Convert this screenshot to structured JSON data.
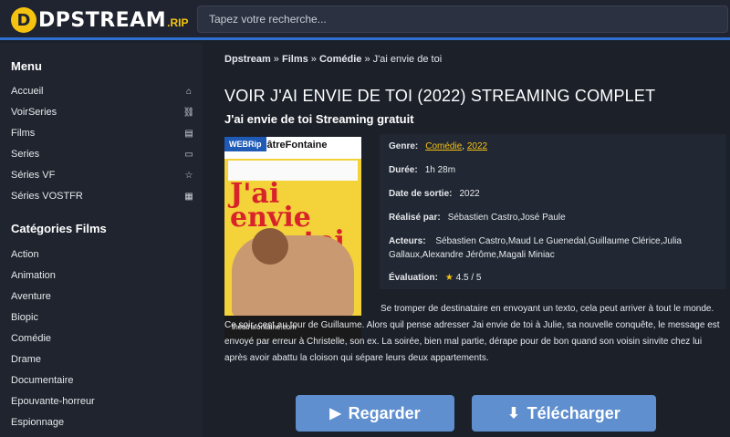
{
  "header": {
    "logo_initial": "D",
    "logo_text": "DPSTREAM",
    "logo_suffix": ".RIP",
    "search_placeholder": "Tapez votre recherche..."
  },
  "sidebar": {
    "menu_title": "Menu",
    "menu_items": [
      {
        "label": "Accueil",
        "icon": "home-icon",
        "glyph": "⌂"
      },
      {
        "label": "VoirSeries",
        "icon": "link-icon",
        "glyph": "⛓"
      },
      {
        "label": "Films",
        "icon": "film-icon",
        "glyph": "▤"
      },
      {
        "label": "Series",
        "icon": "tv-icon",
        "glyph": "▭"
      },
      {
        "label": "Séries VF",
        "icon": "star-icon",
        "glyph": "☆"
      },
      {
        "label": "Séries VOSTFR",
        "icon": "calendar-icon",
        "glyph": "▦"
      }
    ],
    "categories_title": "Catégories Films",
    "categories": [
      "Action",
      "Animation",
      "Aventure",
      "Biopic",
      "Comédie",
      "Drame",
      "Documentaire",
      "Epouvante-horreur",
      "Espionnage"
    ]
  },
  "breadcrumb": {
    "home": "Dpstream",
    "sep": " » ",
    "films": "Films",
    "genre": "Comédie",
    "current": "J'ai envie de toi"
  },
  "page": {
    "title": "VOIR J'AI ENVIE DE TOI (2022) STREAMING COMPLET",
    "subtitle": "J'ai envie de toi Streaming gratuit"
  },
  "poster": {
    "badge": "WEBRip",
    "brand": "théâtreFontaine",
    "big_text_1": "J'ai envie",
    "big_text_2": "de toi",
    "footer": "theatrefontaine.com"
  },
  "info": {
    "genre_label": "Genre:",
    "genre_1": "Comédie",
    "genre_sep": ", ",
    "genre_2": "2022",
    "duree_label": "Durée:",
    "duree": "1h 28m",
    "sortie_label": "Date de sortie:",
    "sortie": "2022",
    "realise_label": "Réalisé par:",
    "realise": "Sébastien Castro,José Paule",
    "acteurs_label": "Acteurs:",
    "acteurs": "Sébastien Castro,Maud Le Guenedal,Guillaume Clérice,Julia Gallaux,Alexandre Jérôme,Magali Miniac",
    "evaluation_label": "Évaluation:",
    "evaluation_star": "★",
    "evaluation": "4.5 / 5"
  },
  "description": {
    "line1": "Se tromper de destinataire en envoyant un texto, cela peut arriver à tout le monde. Ce soir, cest au tour de Guillaume. Alors quil pense adresser Jai envie de toi à Julie, sa nouvelle conquête, le message est envoyé par erreur à Christelle, son ex. La soirée, bien mal partie, dérape pour de bon quand son voisin sinvite chez lui après avoir abattu la cloison qui sépare leurs deux appartements."
  },
  "buttons": {
    "watch_label": "Regarder",
    "watch_icon": "▶",
    "download_label": "Télécharger",
    "download_icon": "⬇"
  },
  "colors": {
    "accent": "#f5c20f",
    "header_border": "#2f6fd1",
    "button": "#5f8fcf"
  }
}
